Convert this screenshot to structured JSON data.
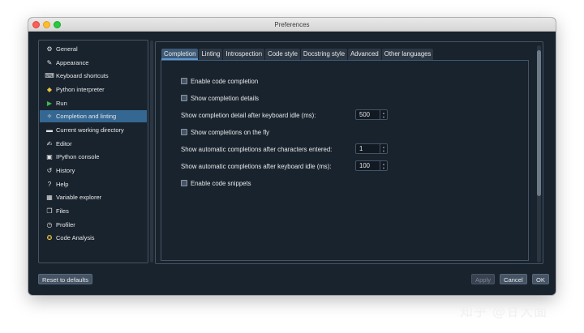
{
  "window": {
    "title": "Preferences"
  },
  "sidebar": {
    "items": [
      {
        "label": "General",
        "icon": "gears-icon",
        "glyph": "⚙"
      },
      {
        "label": "Appearance",
        "icon": "paintbrush-icon",
        "glyph": "✎"
      },
      {
        "label": "Keyboard shortcuts",
        "icon": "keyboard-icon",
        "glyph": "⌨"
      },
      {
        "label": "Python interpreter",
        "icon": "python-icon",
        "glyph": "◆"
      },
      {
        "label": "Run",
        "icon": "play-icon",
        "glyph": "▶"
      },
      {
        "label": "Completion and linting",
        "icon": "completion-icon",
        "glyph": "✧"
      },
      {
        "label": "Current working directory",
        "icon": "folder-icon",
        "glyph": "▬"
      },
      {
        "label": "Editor",
        "icon": "edit-icon",
        "glyph": "✍"
      },
      {
        "label": "IPython console",
        "icon": "console-icon",
        "glyph": "▣"
      },
      {
        "label": "History",
        "icon": "history-icon",
        "glyph": "↺"
      },
      {
        "label": "Help",
        "icon": "help-icon",
        "glyph": "?"
      },
      {
        "label": "Variable explorer",
        "icon": "table-icon",
        "glyph": "▦"
      },
      {
        "label": "Files",
        "icon": "files-icon",
        "glyph": "❐"
      },
      {
        "label": "Profiler",
        "icon": "clock-icon",
        "glyph": "◷"
      },
      {
        "label": "Code Analysis",
        "icon": "search-code-icon",
        "glyph": "✪"
      }
    ],
    "active_index": 5
  },
  "tabs": [
    "Completion",
    "Linting",
    "Introspection",
    "Code style",
    "Docstring style",
    "Advanced",
    "Other languages"
  ],
  "completion": {
    "enable_code_completion": "Enable code completion",
    "show_completion_details": "Show completion details",
    "detail_idle_label": "Show completion detail after keyboard idle (ms):",
    "detail_idle_value": "500",
    "show_on_the_fly": "Show completions on the fly",
    "after_chars_label": "Show automatic completions after characters entered:",
    "after_chars_value": "1",
    "after_idle_label": "Show automatic completions after keyboard idle (ms):",
    "after_idle_value": "100",
    "enable_snippets": "Enable code snippets"
  },
  "buttons": {
    "reset": "Reset to defaults",
    "apply": "Apply",
    "cancel": "Cancel",
    "ok": "OK"
  },
  "watermark": "知乎 @甘大面",
  "colors": {
    "background": "#19232d",
    "selection": "#346792",
    "border": "#455364"
  }
}
